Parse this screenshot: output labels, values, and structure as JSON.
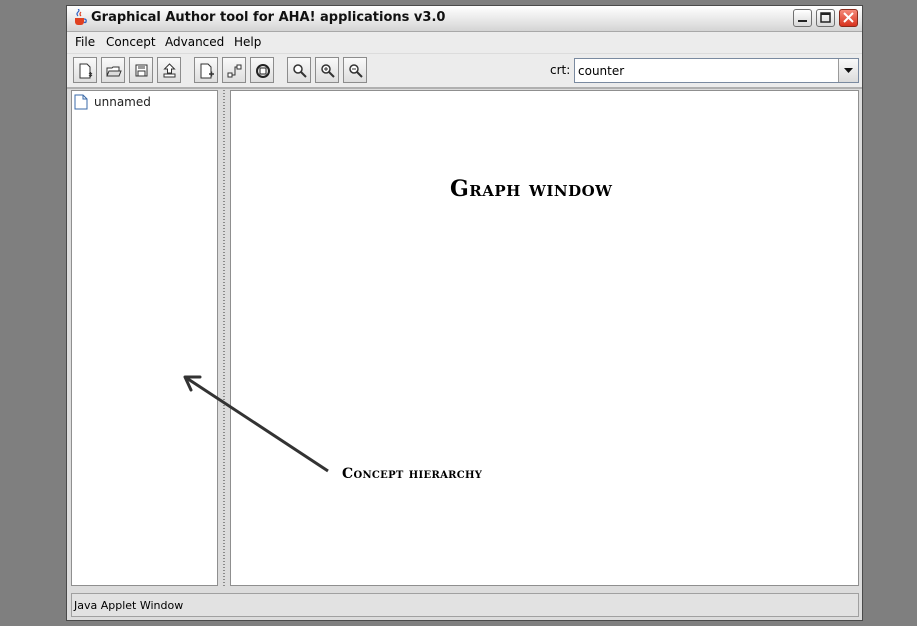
{
  "window": {
    "title": "Graphical Author tool for AHA! applications v3.0",
    "controls": [
      "minimize",
      "maximize",
      "close"
    ]
  },
  "menubar": {
    "items": [
      "File",
      "Concept",
      "Advanced",
      "Help"
    ]
  },
  "toolbar": {
    "buttons": [
      {
        "icon": "new-file-icon"
      },
      {
        "icon": "open-folder-icon"
      },
      {
        "icon": "save-icon"
      },
      {
        "icon": "upload-icon"
      },
      {
        "icon": "new-concept-icon"
      },
      {
        "icon": "connect-icon"
      },
      {
        "icon": "refresh-icon"
      },
      {
        "icon": "zoom-icon"
      },
      {
        "icon": "zoom-in-icon"
      },
      {
        "icon": "zoom-out-icon"
      }
    ],
    "crt_label": "crt:",
    "crt_value": "counter"
  },
  "tree": {
    "items": [
      {
        "label": "unnamed",
        "icon": "document-icon"
      }
    ]
  },
  "annotations": {
    "graph_window": "Graph window",
    "concept_hierarchy": "Concept hierarchy"
  },
  "statusbar": {
    "text": "Java Applet Window"
  },
  "colors": {
    "desktop": "#7f7f7f",
    "window_bg": "#dcdcdc",
    "panel_bg": "#ffffff",
    "close_button": "#d8321d"
  }
}
